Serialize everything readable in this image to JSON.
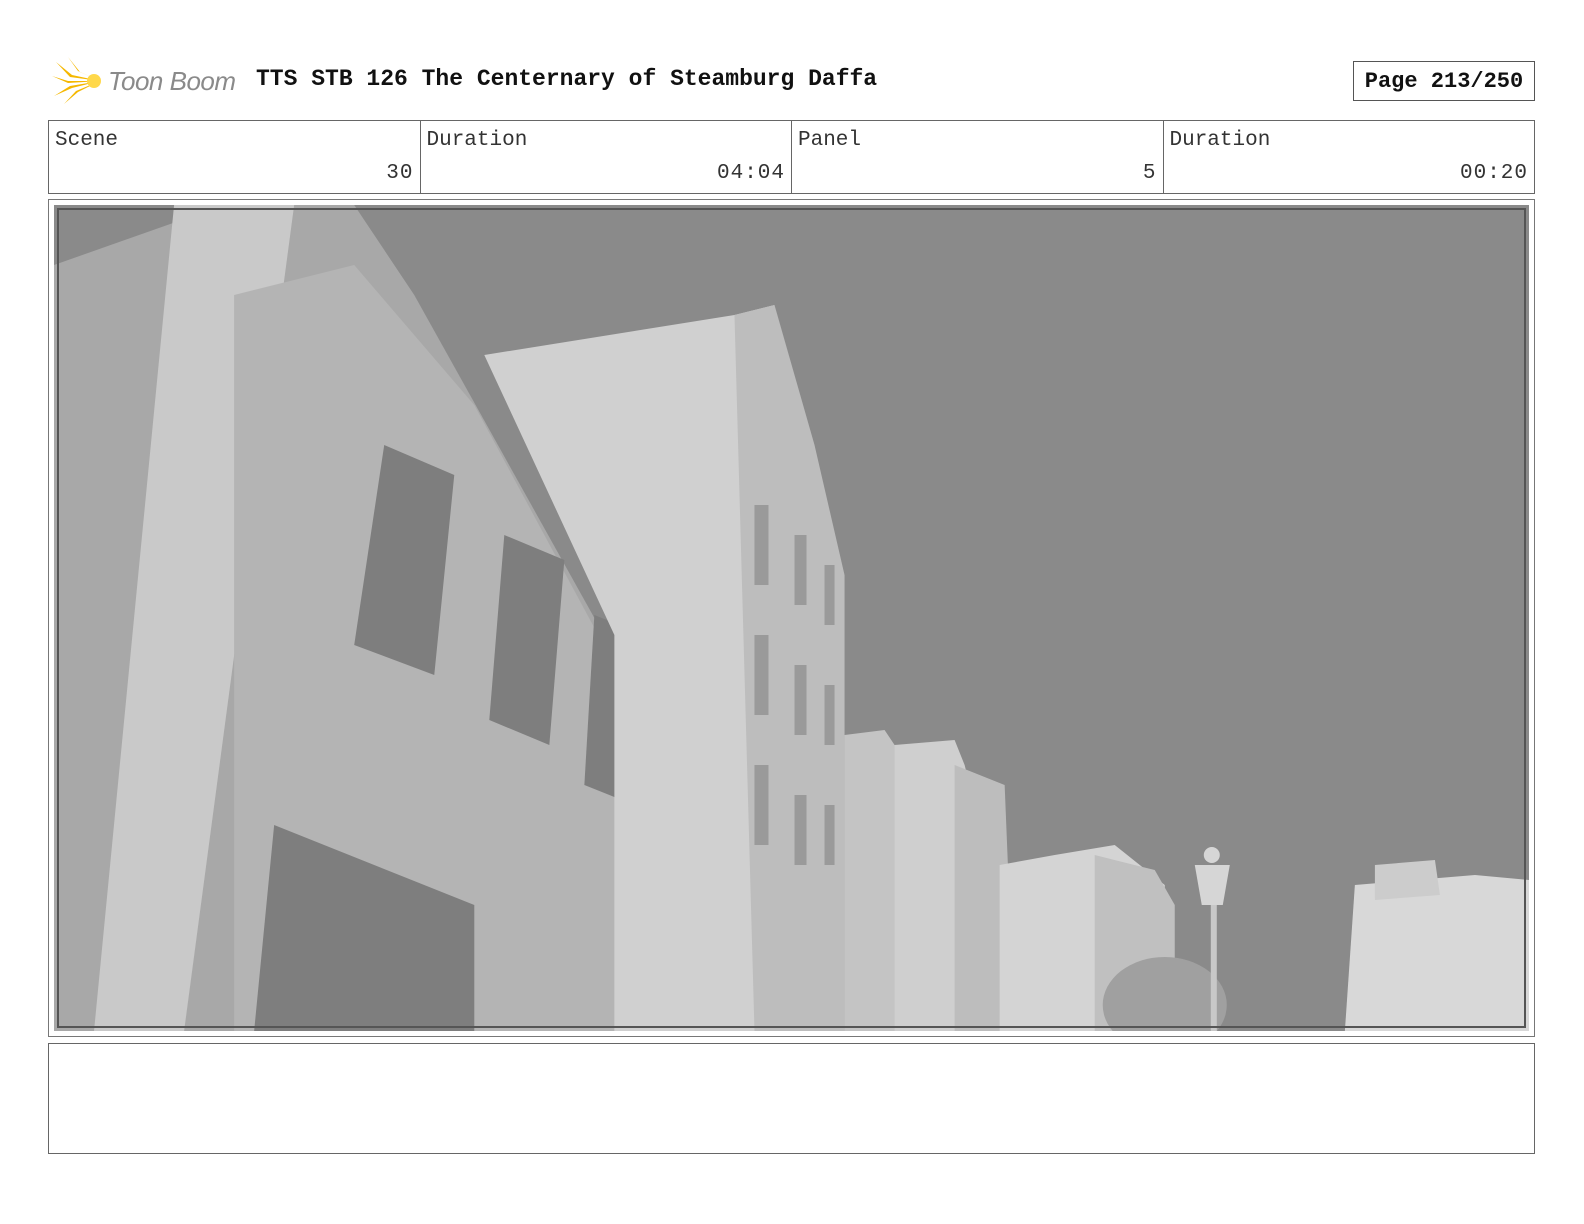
{
  "header": {
    "logo_text": "Toon Boom",
    "title": "TTS STB 126 The Centernary of Steamburg Daffa",
    "page_label": "Page 213/250"
  },
  "info": {
    "scene_label": "Scene",
    "scene_value": "30",
    "scene_duration_label": "Duration",
    "scene_duration_value": "04:04",
    "panel_label": "Panel",
    "panel_value": "5",
    "panel_duration_label": "Duration",
    "panel_duration_value": "00:20"
  },
  "notes": {
    "text": ""
  },
  "colors": {
    "logo_accent": "#f5b800",
    "sky": "#8a8a8a",
    "building_light": "#d0d0d0",
    "building_shade": "#9a9a9a"
  }
}
